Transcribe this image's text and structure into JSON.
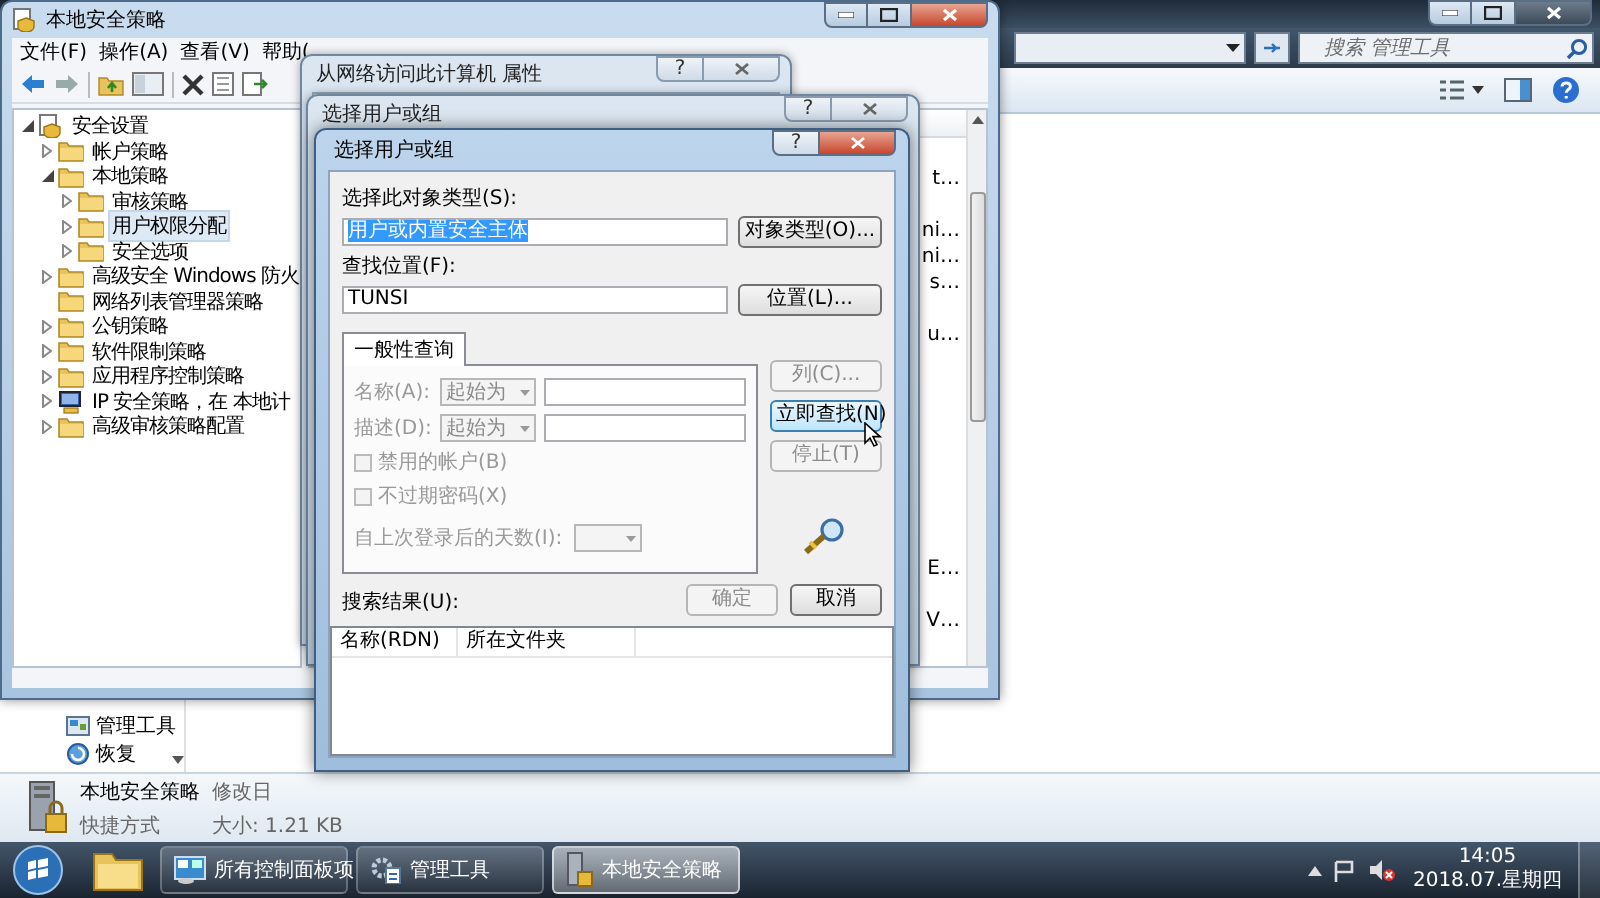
{
  "explorer": {
    "search": {
      "placeholder": "搜索 管理工具"
    },
    "nav_items": [
      {
        "label": "管理工具",
        "kind": "tools"
      },
      {
        "label": "恢复",
        "kind": "restore"
      }
    ],
    "details": {
      "name": "本地安全策略",
      "modified": "修改日",
      "type": "快捷方式",
      "size": "大小: 1.21 KB"
    }
  },
  "mmc": {
    "title": "本地安全策略",
    "menu": [
      "文件(F)",
      "操作(A)",
      "查看(V)",
      "帮助("
    ],
    "tree": [
      {
        "label": "安全设置",
        "kind": "root",
        "selected": false,
        "expanded": true,
        "children": [
          {
            "label": "帐户策略",
            "kind": "folder",
            "selected": false,
            "expanded": false
          },
          {
            "label": "本地策略",
            "kind": "folder",
            "selected": false,
            "expanded": true,
            "children": [
              {
                "label": "审核策略",
                "kind": "folder",
                "selected": false,
                "expanded": false
              },
              {
                "label": "用户权限分配",
                "kind": "folder",
                "selected": true,
                "expanded": false
              },
              {
                "label": "安全选项",
                "kind": "folder",
                "selected": false,
                "expanded": false
              }
            ]
          },
          {
            "label": "高级安全 Windows 防火",
            "kind": "folder",
            "selected": false,
            "expanded": false
          },
          {
            "label": "网络列表管理器策略",
            "kind": "folder",
            "selected": false
          },
          {
            "label": "公钥策略",
            "kind": "folder",
            "selected": false,
            "expanded": false
          },
          {
            "label": "软件限制策略",
            "kind": "folder",
            "selected": false,
            "expanded": false
          },
          {
            "label": "应用程序控制策略",
            "kind": "folder",
            "selected": false,
            "expanded": false
          },
          {
            "label": "IP 安全策略，在 本地计",
            "kind": "network",
            "selected": false,
            "expanded": false
          },
          {
            "label": "高级审核策略配置",
            "kind": "folder",
            "selected": false,
            "expanded": false
          }
        ]
      }
    ],
    "policy_fragments": [
      "t…",
      "ni…",
      "ni…",
      "s…",
      "u…",
      "E…",
      "V…"
    ]
  },
  "back_dialogs": [
    {
      "title": "从网络访问此计算机 属性",
      "help": "?"
    },
    {
      "title": "选择用户或组",
      "help": "?"
    }
  ],
  "select_dialog": {
    "title": "选择用户或组",
    "help": "?",
    "object_type": {
      "label": "选择此对象类型(S):",
      "value": "用户或内置安全主体",
      "text_selected": true,
      "button": "对象类型(O)..."
    },
    "location": {
      "label": "查找位置(F):",
      "value": "TUNSI",
      "button": "位置(L)..."
    },
    "query_tabs": [
      {
        "label": "一般性查询",
        "selected": true
      }
    ],
    "fields": [
      {
        "label": "名称(A):",
        "operator": "起始为",
        "disabled": true
      },
      {
        "label": "描述(D):",
        "operator": "起始为",
        "disabled": true
      }
    ],
    "checkboxes": [
      {
        "label": "禁用的帐户(B)",
        "checked": false,
        "disabled": true
      },
      {
        "label": "不过期密码(X)",
        "checked": false,
        "disabled": true
      }
    ],
    "days": {
      "label": "自上次登录后的天数(I):",
      "disabled": true
    },
    "side_buttons": [
      {
        "label": "列(C)...",
        "disabled": true,
        "focused": false
      },
      {
        "label": "立即查找(N)",
        "disabled": false,
        "focused": true
      },
      {
        "label": "停止(T)",
        "disabled": true,
        "focused": false
      }
    ],
    "buttons": [
      {
        "label": "确定",
        "disabled": true
      },
      {
        "label": "取消",
        "disabled": false
      }
    ],
    "results_label": "搜索结果(U):",
    "columns": [
      "名称(RDN)",
      "所在文件夹"
    ]
  },
  "taskbar": {
    "buttons": [
      {
        "label": "所有控制面板项",
        "kind": "control-panel",
        "selected": false
      },
      {
        "label": "管理工具",
        "kind": "tools",
        "selected": false
      },
      {
        "label": "本地安全策略",
        "kind": "policy",
        "selected": true
      }
    ],
    "clock": {
      "time": "14:05",
      "date": "2018.07.星期四"
    }
  }
}
